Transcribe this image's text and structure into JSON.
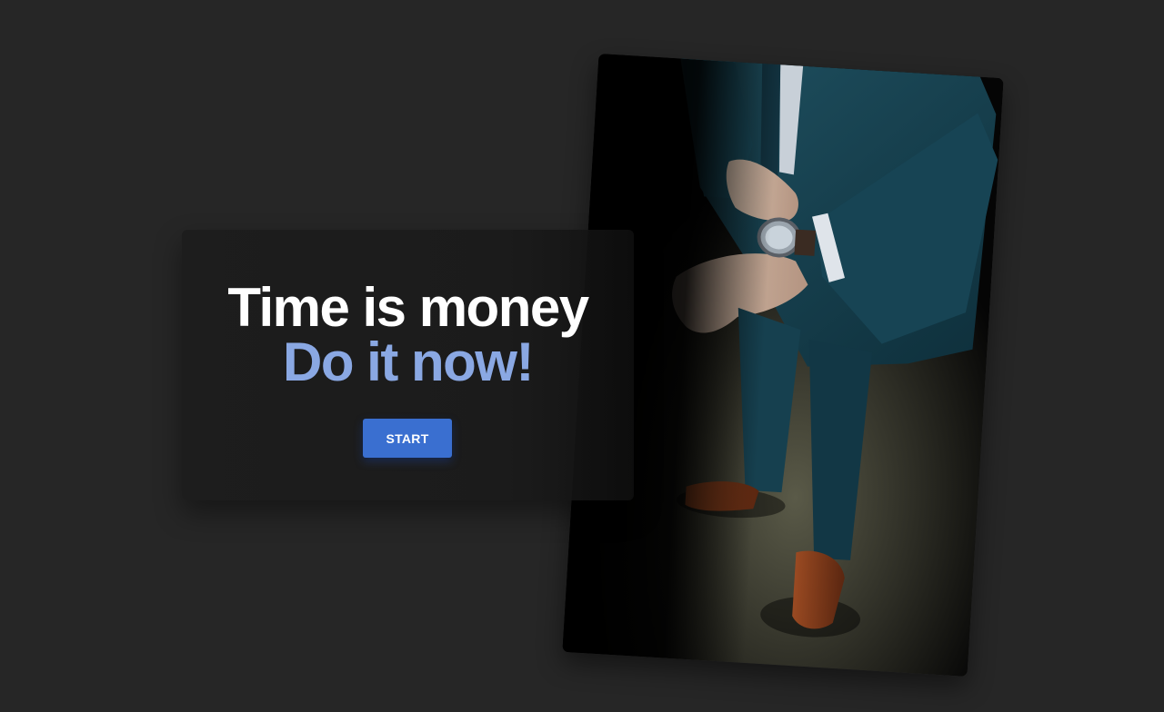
{
  "hero": {
    "title_line1": "Time is money",
    "title_line2": "Do it now!",
    "start_label": "START"
  },
  "colors": {
    "background": "#262626",
    "card": "#1d1d1d",
    "accent_text": "#8aa8e3",
    "button": "#3a6fd0"
  },
  "photo": {
    "subject": "man-in-blue-suit-checking-wristwatch"
  }
}
